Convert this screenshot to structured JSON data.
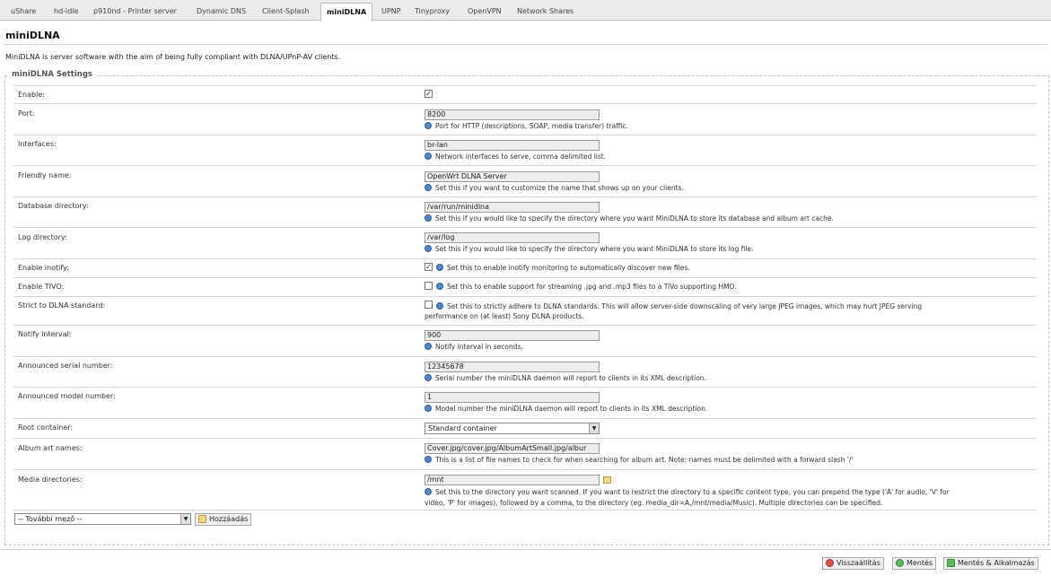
{
  "tabs": [
    {
      "label": "uShare",
      "active": false
    },
    {
      "label": "hd-idle",
      "active": false
    },
    {
      "label": "p910nd - Printer server",
      "active": false
    },
    {
      "label": "Dynamic DNS",
      "active": false
    },
    {
      "label": "Client-Splash",
      "active": false
    },
    {
      "label": "miniDLNA",
      "active": true
    },
    {
      "label": "UPNP",
      "active": false
    },
    {
      "label": "Tinyproxy",
      "active": false
    },
    {
      "label": "OpenVPN",
      "active": false
    },
    {
      "label": "Network Shares",
      "active": false
    }
  ],
  "page": {
    "title": "miniDLNA",
    "description": "MiniDLNA is server software with the aim of being fully compliant with DLNA/UPnP-AV clients."
  },
  "section": {
    "legend": "miniDLNA Settings",
    "fields": {
      "enable": {
        "label": "Enable:",
        "checked": true
      },
      "port": {
        "label": "Port:",
        "value": "8200",
        "hint": "Port for HTTP (descriptions, SOAP, media transfer) traffic."
      },
      "interfaces": {
        "label": "Interfaces:",
        "value": "br-lan",
        "hint": "Network interfaces to serve, comma delimited list."
      },
      "friendly_name": {
        "label": "Friendly name:",
        "value": "OpenWrt DLNA Server",
        "hint": "Set this if you want to customize the name that shows up on your clients."
      },
      "db_dir": {
        "label": "Database directory:",
        "value": "/var/run/minidlna",
        "hint": "Set this if you would like to specify the directory where you want MiniDLNA to store its database and album art cache."
      },
      "log_dir": {
        "label": "Log directory:",
        "value": "/var/log",
        "hint": "Set this if you would like to specify the directory where you want MiniDLNA to store its log file."
      },
      "inotify": {
        "label": "Enable inotify:",
        "checked": true,
        "hint": "Set this to enable inotify monitoring to automatically discover new files."
      },
      "tivo": {
        "label": "Enable TIVO:",
        "checked": false,
        "hint": "Set this to enable support for streaming .jpg and .mp3 files to a TiVo supporting HMO."
      },
      "strict": {
        "label": "Strict to DLNA standard:",
        "checked": false,
        "hint_line1": "Set this to strictly adhere to DLNA standards. This will allow server-side downscaling of very large JPEG images, which may hurt JPEG serving",
        "hint_line2": "performance on (at least) Sony DLNA products."
      },
      "notify": {
        "label": "Notify interval:",
        "value": "900",
        "hint": "Notify interval in seconds."
      },
      "serial": {
        "label": "Announced serial number:",
        "value": "12345678",
        "hint": "Serial number the miniDLNA daemon will report to clients in its XML description."
      },
      "model": {
        "label": "Announced model number:",
        "value": "1",
        "hint": "Model number the miniDLNA daemon will report to clients in its XML description."
      },
      "root": {
        "label": "Root container:",
        "value": "Standard container"
      },
      "album_art": {
        "label": "Album art names:",
        "value": "Cover.jpg/cover.jpg/AlbumArtSmall.jpg/albur",
        "hint": "This is a list of file names to check for when searching for album art. Note: names must be delimited with a forward slash '/'"
      },
      "media": {
        "label": "Media directories:",
        "value": "/mnt",
        "hint_line1": "Set this to the directory you want scanned. If you want to restrict the directory to a specific content type, you can prepend the type ('A' for audio, 'V' for",
        "hint_line2": "video, 'P' for images), followed by a comma, to the directory (eg. media_dir=A,/mnt/media/Music). Multiple directories can be specified."
      }
    },
    "extra_field_select": "-- További mező --",
    "add_button": "Hozzáadás"
  },
  "footer": {
    "reset": "Visszaállítás",
    "save": "Mentés",
    "save_apply": "Mentés & Alkalmazás"
  }
}
